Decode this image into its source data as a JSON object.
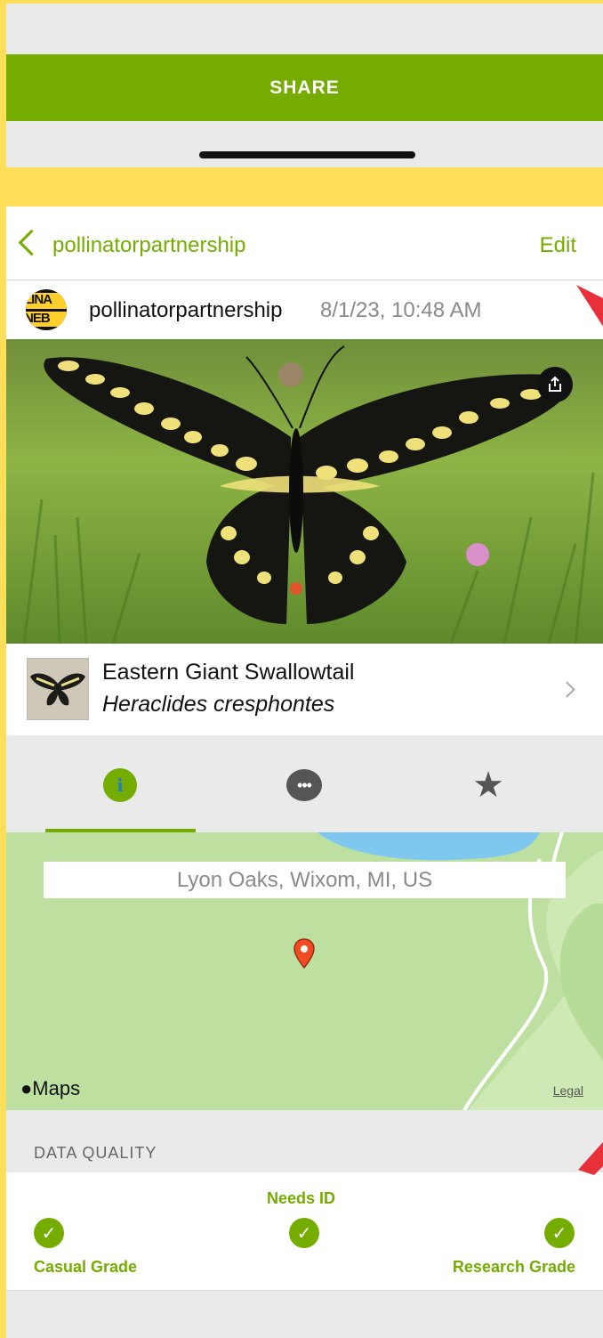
{
  "top_sheet": {
    "share_label": "SHARE"
  },
  "nav": {
    "back_label": "pollinatorpartnership",
    "edit_label": "Edit"
  },
  "observation": {
    "username": "pollinatorpartnership",
    "date": "8/1/23, 10:48 AM",
    "avatar_text_top": "LINA",
    "avatar_text_bottom": "NEB"
  },
  "taxon": {
    "common_name": "Eastern Giant Swallowtail",
    "scientific_name": "Heraclides cresphontes"
  },
  "tabs": [
    {
      "name": "info",
      "icon": "info-icon",
      "glyph": "i",
      "active": true
    },
    {
      "name": "comments",
      "icon": "comment-bubble-icon",
      "glyph": "•••",
      "active": false
    },
    {
      "name": "favorites",
      "icon": "star-icon",
      "glyph": "★",
      "active": false
    }
  ],
  "map": {
    "location": "Lyon Oaks, Wixom, MI, US",
    "maps_label": "Maps",
    "legal_label": "Legal"
  },
  "data_quality": {
    "title": "DATA QUALITY",
    "grades": [
      "Casual Grade",
      "Needs ID",
      "Research Grade"
    ]
  },
  "colors": {
    "accent": "#74ac00",
    "frame": "#ffde59",
    "annotation_arrow": "#e8303a"
  }
}
